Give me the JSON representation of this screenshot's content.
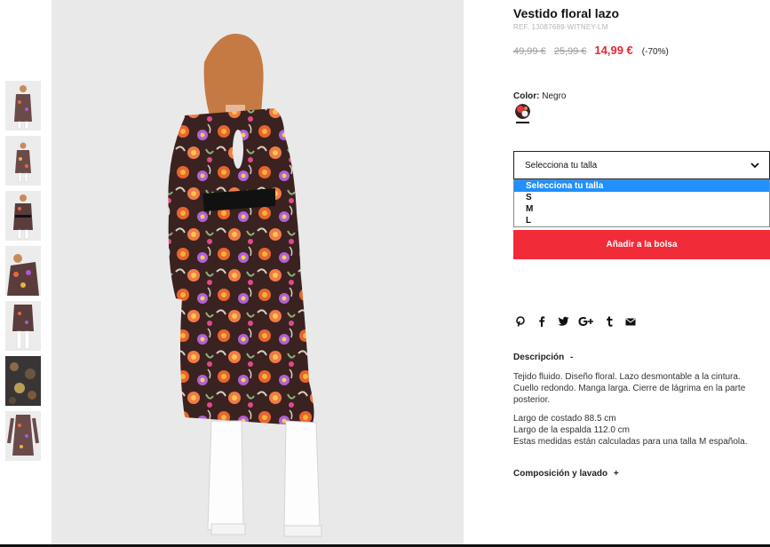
{
  "product": {
    "title": "Vestido floral lazo",
    "ref": "REF. 13087689-WITNEY-LM",
    "price_original": "49,99 €",
    "price_previous": "25,99 €",
    "price_sale": "14,99 €",
    "discount": "(-70%)"
  },
  "color": {
    "label": "Color:",
    "value": "Negro",
    "swatch_icon": "floral-swatch"
  },
  "size": {
    "placeholder": "Selecciona tu talla",
    "options": [
      "Selecciona tu talla",
      "S",
      "M",
      "L"
    ],
    "selected": "Selecciona tu talla"
  },
  "actions": {
    "add_to_bag": "Añadir a la bolsa"
  },
  "share": {
    "icons": [
      "pinterest-icon",
      "facebook-icon",
      "twitter-icon",
      "google-plus-icon",
      "tumblr-icon",
      "email-icon"
    ]
  },
  "description": {
    "heading": "Descripción",
    "toggle": "-",
    "para1_line1": "Tejido fluido. Diseño floral. Lazo desmontable a la cintura.",
    "para1_line2": "Cuello redondo. Manga larga. Cierre de lágrima en la parte",
    "para1_line3": "posterior.",
    "para2_line1": "Largo de costado 88.5 cm",
    "para2_line2": "Largo de la espalda 112.0 cm",
    "para2_line3": "Estas medidas están calculadas para una talla M española."
  },
  "composition": {
    "heading": "Composición y lavado",
    "toggle": "+"
  },
  "colors": {
    "accent_red": "#f22b38",
    "sale_red": "#e5282f",
    "select_blue": "#1e90ff"
  }
}
